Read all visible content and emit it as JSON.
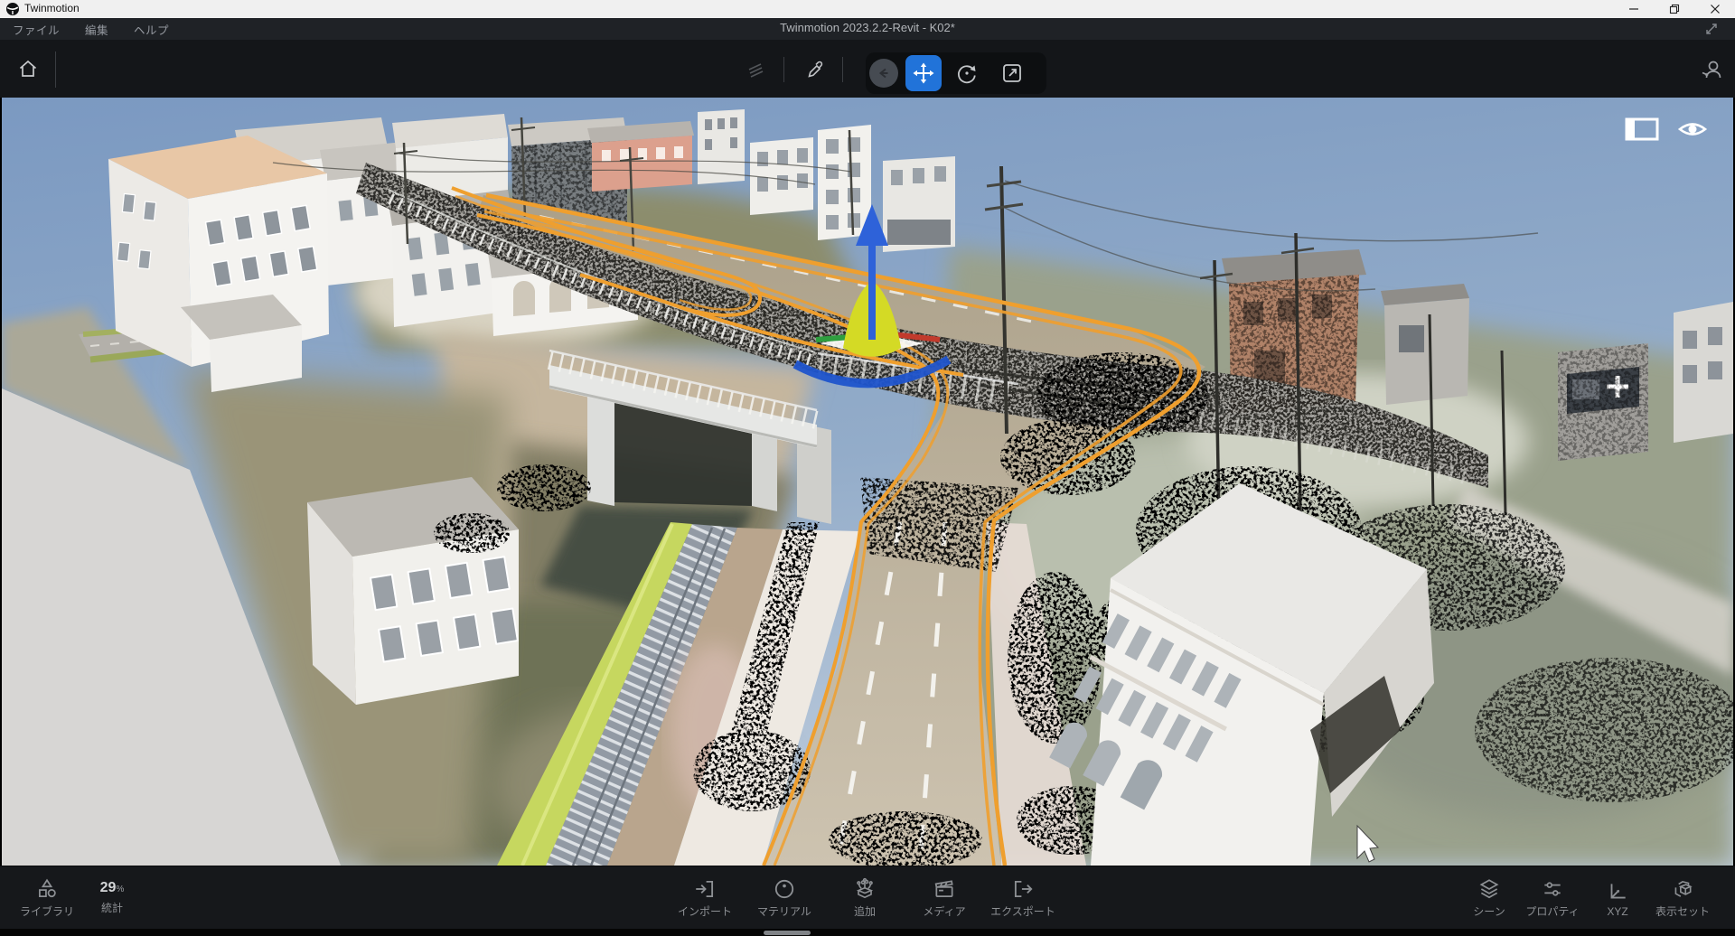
{
  "window": {
    "app_title": "Twinmotion",
    "controls": [
      "minimize-icon",
      "restore-icon",
      "close-icon"
    ]
  },
  "menu": {
    "items": [
      {
        "label": "ファイル"
      },
      {
        "label": "編集"
      },
      {
        "label": "ヘルプ"
      }
    ],
    "document_title": "Twinmotion 2023.2.2-Revit - K02*",
    "expand_icon": "expand-diagonal-icon"
  },
  "toolbar": {
    "left_icons": [
      "home-icon"
    ],
    "center_icons": [
      "stack-lines-icon",
      "eyedropper-icon",
      "back-circle-icon",
      "move-tool-icon",
      "rotate-tool-icon",
      "scale-tool-icon"
    ],
    "selected_tool": "move",
    "right_icons": [
      "collaboration-person-icon"
    ]
  },
  "viewport": {
    "overlay_icons": [
      "panel-layout-icon",
      "eye-visibility-icon"
    ],
    "scene_description": "Japanese townscape 3D model with railway bridge, level crossing, photogrammetry point cloud, selected orange path splines and move gizmo",
    "gizmo": {
      "axis_up_color": "#2e62d9",
      "axis_left_color": "#2f9e3f",
      "axis_right_color": "#c23a2c",
      "cone_color": "#d4da25",
      "ring_color": "#1f54cc"
    },
    "selection_color": "#ef9f2e"
  },
  "bottom_bar": {
    "library": {
      "icon": "library-icon",
      "label": "ライブラリ"
    },
    "stats": {
      "value": "29",
      "unit": "%",
      "label": "統計"
    },
    "center": [
      {
        "icon": "import-icon",
        "label": "インポート"
      },
      {
        "icon": "material-icon",
        "label": "マテリアル"
      },
      {
        "icon": "add-vegetation-icon",
        "label": "追加"
      },
      {
        "icon": "media-icon",
        "label": "メディア"
      },
      {
        "icon": "export-icon",
        "label": "エクスポート"
      }
    ],
    "right": [
      {
        "icon": "scene-layers-icon",
        "label": "シーン"
      },
      {
        "icon": "properties-sliders-icon",
        "label": "プロパティ"
      },
      {
        "icon": "xyz-axis-icon",
        "label": "XYZ"
      },
      {
        "icon": "display-set-icon",
        "label": "表示セット"
      }
    ]
  },
  "colors": {
    "accent_blue": "#2173d9",
    "titlebar_bg": "#f0f0f0",
    "chrome_bg": "#16181b"
  }
}
